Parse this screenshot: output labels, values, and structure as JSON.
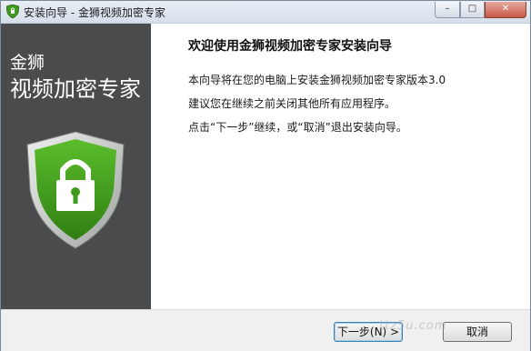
{
  "window": {
    "title": "安装向导 - 金狮视频加密专家",
    "controls": {
      "minimize": "–",
      "maximize": "□",
      "close": "✕"
    }
  },
  "banner": {
    "brand_line1": "金狮",
    "brand_line2": "视频加密专家",
    "colors": {
      "background": "#4a4b4c",
      "shield_green": "#3f9b1e",
      "shield_silver": "#c9ccc9"
    }
  },
  "content": {
    "heading": "欢迎使用金狮视频加密专家安装向导",
    "paragraphs": [
      "本向导将在您的电脑上安装金狮视频加密专家版本3.0",
      "建议您在继续之前关闭其他所有应用程序。",
      "点击“下一步”继续，或“取消”退出安装向导。"
    ]
  },
  "buttons": {
    "next_label": "下一步(N) >",
    "cancel_label": "取消"
  },
  "watermark": "ttz5u.com"
}
